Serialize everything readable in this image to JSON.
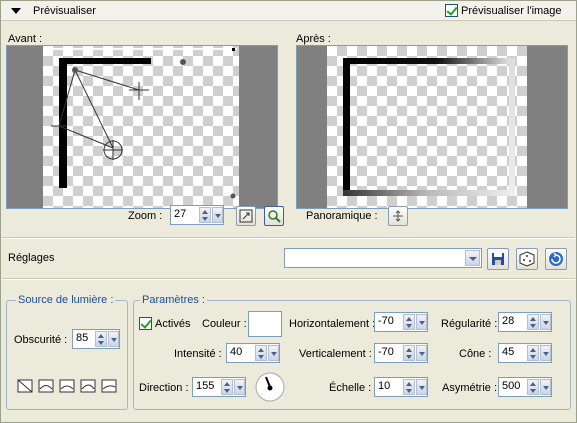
{
  "header": {
    "title": "Prévisualiser",
    "preview_checkbox_label": "Prévisualiser l'image",
    "preview_checked": true
  },
  "preview": {
    "before_label": "Avant :",
    "after_label": "Après :"
  },
  "zoom": {
    "label": "Zoom :",
    "value": "27"
  },
  "pan": {
    "label": "Panoramique :"
  },
  "settings": {
    "label": "Réglages",
    "preset_value": ""
  },
  "light_source": {
    "group_label": "Source de lumière :",
    "darkness_label": "Obscurité :",
    "darkness_value": "85",
    "presets_count_shown": 5
  },
  "params": {
    "group_label": "Paramètres :",
    "active_label": "Activés",
    "active_checked": true,
    "color_label": "Couleur :",
    "color": "#ffffff",
    "intensity_label": "Intensité :",
    "intensity_value": "40",
    "direction_label": "Direction :",
    "direction_value": "155",
    "horizontal_label": "Horizontalement :",
    "horizontal_value": "-70",
    "vertical_label": "Verticalement :",
    "vertical_value": "-70",
    "scale_label": "Échelle :",
    "scale_value": "10",
    "regularity_label": "Régularité :",
    "regularity_value": "28",
    "cone_label": "Cône :",
    "cone_value": "45",
    "asymmetry_label": "Asymétrie :",
    "asymmetry_value": "500"
  },
  "colors": {
    "background": "#eceadb",
    "group_label": "#1a4fa0",
    "checkmark": "#21a121",
    "preview_gray": "#808080"
  }
}
